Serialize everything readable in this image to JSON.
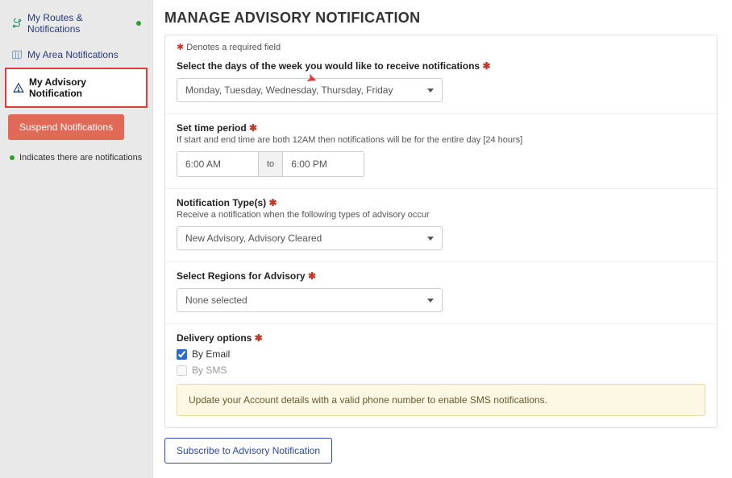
{
  "sidebar": {
    "items": [
      {
        "label": "My Routes & Notifications",
        "has_dot": true
      },
      {
        "label": "My Area Notifications",
        "has_dot": false
      },
      {
        "label": "My Advisory Notification",
        "has_dot": false
      }
    ],
    "suspend_label": "Suspend Notifications",
    "legend": "Indicates there are notifications"
  },
  "page": {
    "title": "MANAGE ADVISORY NOTIFICATION",
    "required_note": "Denotes a required field"
  },
  "days": {
    "label": "Select the days of the week you would like to receive notifications",
    "value": "Monday, Tuesday, Wednesday, Thursday, Friday"
  },
  "time": {
    "label": "Set time period",
    "help": "If start and end time are both 12AM then notifications will be for the entire day [24 hours]",
    "start": "6:00 AM",
    "sep": "to",
    "end": "6:00 PM"
  },
  "types": {
    "label": "Notification Type(s)",
    "help": "Receive a notification when the following types of advisory occur",
    "value": "New Advisory, Advisory Cleared"
  },
  "regions": {
    "label": "Select Regions for Advisory",
    "value": "None selected"
  },
  "delivery": {
    "label": "Delivery options",
    "email_label": "By Email",
    "sms_label": "By SMS",
    "alert": "Update your Account details with a valid phone number to enable SMS notifications."
  },
  "actions": {
    "subscribe": "Subscribe to Advisory Notification"
  }
}
